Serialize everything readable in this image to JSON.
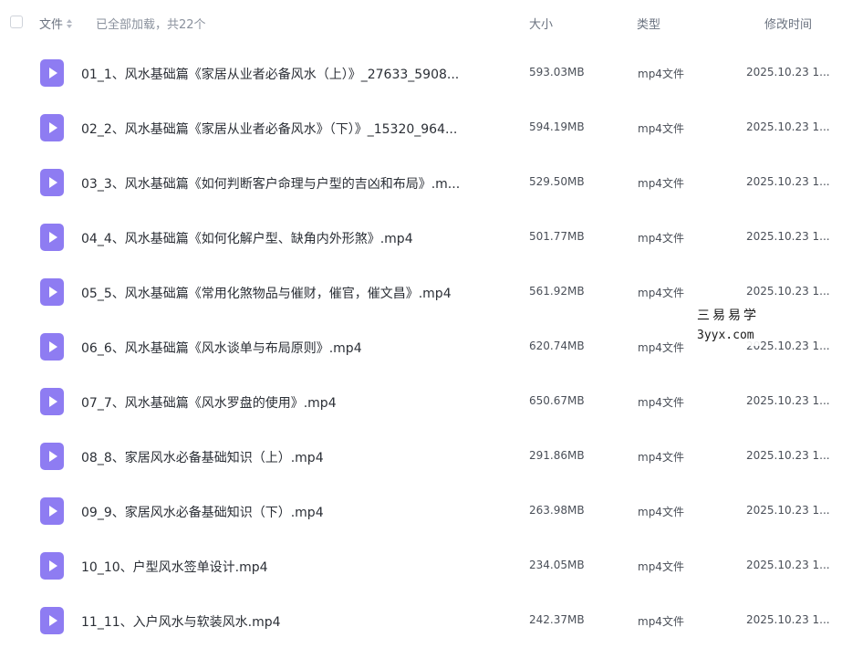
{
  "header": {
    "col_name": "文件",
    "loaded_info": "已全部加载，共22个",
    "col_size": "大小",
    "col_type": "类型",
    "col_time": "修改时间"
  },
  "files": [
    {
      "name": "01_1、风水基础篇《家居从业者必备风水（上）》_27633_5908...",
      "size": "593.03MB",
      "type": "mp4文件",
      "time": "2025.10.23 1..."
    },
    {
      "name": "02_2、风水基础篇《家居从业者必备风水》（下）》_15320_964...",
      "size": "594.19MB",
      "type": "mp4文件",
      "time": "2025.10.23 1..."
    },
    {
      "name": "03_3、风水基础篇《如何判断客户命理与户型的吉凶和布局》.m...",
      "size": "529.50MB",
      "type": "mp4文件",
      "time": "2025.10.23 1..."
    },
    {
      "name": "04_4、风水基础篇《如何化解户型、缺角内外形煞》.mp4",
      "size": "501.77MB",
      "type": "mp4文件",
      "time": "2025.10.23 1..."
    },
    {
      "name": "05_5、风水基础篇《常用化煞物品与催财，催官，催文昌》.mp4",
      "size": "561.92MB",
      "type": "mp4文件",
      "time": "2025.10.23 1..."
    },
    {
      "name": "06_6、风水基础篇《风水谈单与布局原则》.mp4",
      "size": "620.74MB",
      "type": "mp4文件",
      "time": "2025.10.23 1..."
    },
    {
      "name": "07_7、风水基础篇《风水罗盘的使用》.mp4",
      "size": "650.67MB",
      "type": "mp4文件",
      "time": "2025.10.23 1..."
    },
    {
      "name": "08_8、家居风水必备基础知识（上）.mp4",
      "size": "291.86MB",
      "type": "mp4文件",
      "time": "2025.10.23 1..."
    },
    {
      "name": "09_9、家居风水必备基础知识（下）.mp4",
      "size": "263.98MB",
      "type": "mp4文件",
      "time": "2025.10.23 1..."
    },
    {
      "name": "10_10、户型风水签单设计.mp4",
      "size": "234.05MB",
      "type": "mp4文件",
      "time": "2025.10.23 1..."
    },
    {
      "name": "11_11、入户风水与软装风水.mp4",
      "size": "242.37MB",
      "type": "mp4文件",
      "time": "2025.10.23 1..."
    }
  ],
  "watermark": {
    "line1": "三易易学",
    "line2": "3yyx.com"
  },
  "colors": {
    "file_icon": "#8e7cf2",
    "header_text": "#6b7380"
  },
  "icons": {
    "file_icon": "video-file-icon",
    "sort": "sort-icon",
    "select_all": "checkbox"
  }
}
